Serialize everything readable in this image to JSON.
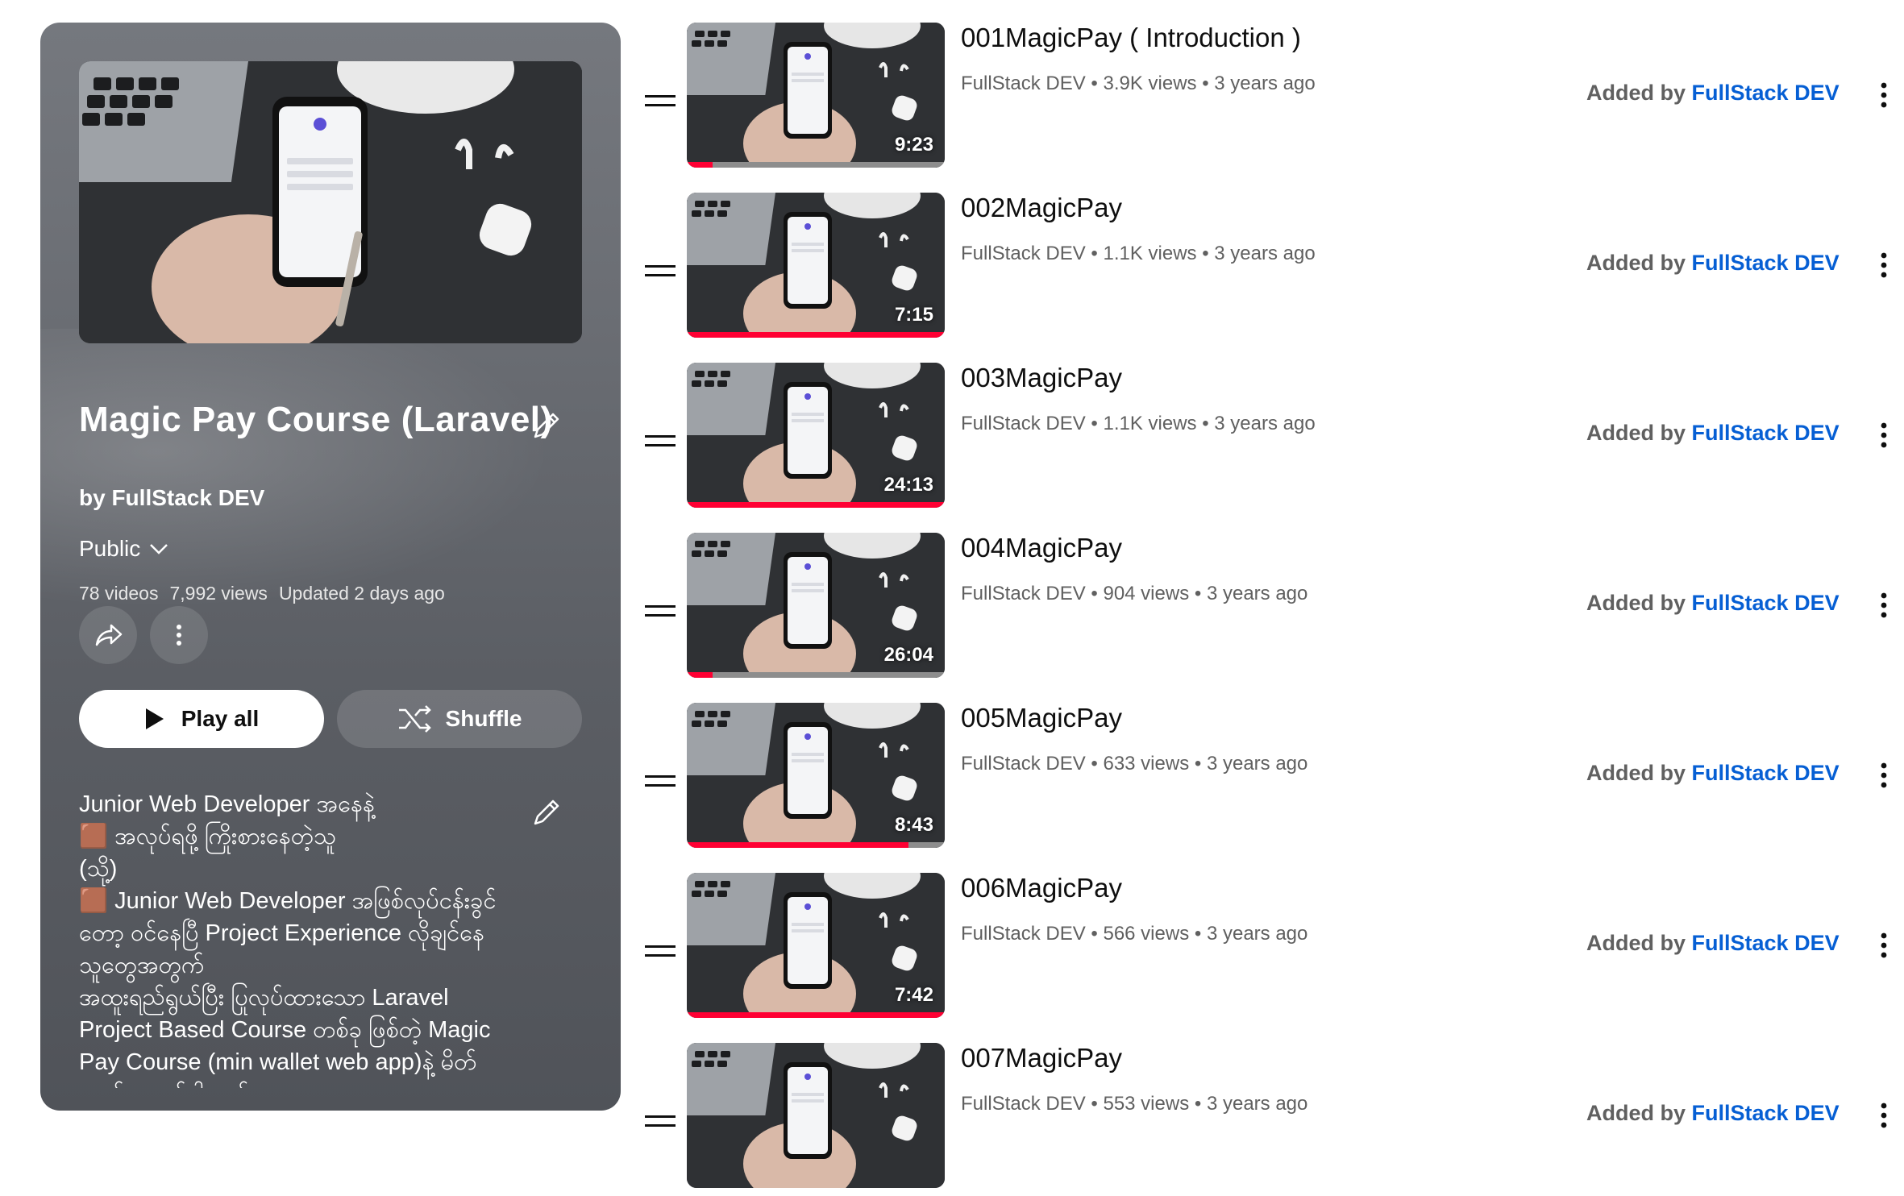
{
  "playlist": {
    "title": "Magic Pay Course (Laravel)",
    "owner": "by FullStack DEV",
    "privacy": "Public",
    "video_count": "78 videos",
    "views": "7,992 views",
    "updated": "Updated 2 days ago",
    "play_all_label": "Play all",
    "shuffle_label": "Shuffle",
    "description": "Junior Web Developer အနေနဲ့\n🟫 အလုပ်ရဖို့ ကြိုးစားနေတဲ့သူ\n(သို့)\n🟫 Junior Web Developer အဖြစ်လုပ်ငန်းခွင်\nတော့ ဝင်နေပြီ Project Experience လိုချင်နေ\nသူတွေအတွက်\nအထူးရည်ရွယ်ပြီး ပြုလုပ်ထားသော Laravel\nProject Based Course တစ်ခု ဖြစ်တဲ့ Magic\nPay Course (min wallet web app)နဲ့ မိတ်\nဆက်ပေးချင်ပါတယ်"
  },
  "icons": {
    "edit": "pencil-icon",
    "privacy_toggle": "chevron-down-icon",
    "share": "share-icon",
    "more": "more-vert-icon",
    "play": "play-icon",
    "shuffle": "shuffle-icon",
    "drag": "drag-handle-icon"
  },
  "colors": {
    "accent_link": "#065fd4",
    "progress": "#ff0033",
    "panel": "#62656b"
  },
  "videos": [
    {
      "title": "001MagicPay ( Introduction )",
      "channel": "FullStack DEV",
      "views": "3.9K views",
      "age": "3 years ago",
      "duration": "9:23",
      "watched": 0.1,
      "added_prefix": "Added by",
      "added_by": "FullStack DEV"
    },
    {
      "title": "002MagicPay",
      "channel": "FullStack DEV",
      "views": "1.1K views",
      "age": "3 years ago",
      "duration": "7:15",
      "watched": 1.0,
      "added_prefix": "Added by",
      "added_by": "FullStack DEV"
    },
    {
      "title": "003MagicPay",
      "channel": "FullStack DEV",
      "views": "1.1K views",
      "age": "3 years ago",
      "duration": "24:13",
      "watched": 1.0,
      "added_prefix": "Added by",
      "added_by": "FullStack DEV"
    },
    {
      "title": "004MagicPay",
      "channel": "FullStack DEV",
      "views": "904 views",
      "age": "3 years ago",
      "duration": "26:04",
      "watched": 0.1,
      "added_prefix": "Added by",
      "added_by": "FullStack DEV"
    },
    {
      "title": "005MagicPay",
      "channel": "FullStack DEV",
      "views": "633 views",
      "age": "3 years ago",
      "duration": "8:43",
      "watched": 0.86,
      "added_prefix": "Added by",
      "added_by": "FullStack DEV"
    },
    {
      "title": "006MagicPay",
      "channel": "FullStack DEV",
      "views": "566 views",
      "age": "3 years ago",
      "duration": "7:42",
      "watched": 1.0,
      "added_prefix": "Added by",
      "added_by": "FullStack DEV"
    },
    {
      "title": "007MagicPay",
      "channel": "FullStack DEV",
      "views": "553 views",
      "age": "3 years ago",
      "duration": "",
      "watched": 0,
      "added_prefix": "Added by",
      "added_by": "FullStack DEV"
    }
  ]
}
